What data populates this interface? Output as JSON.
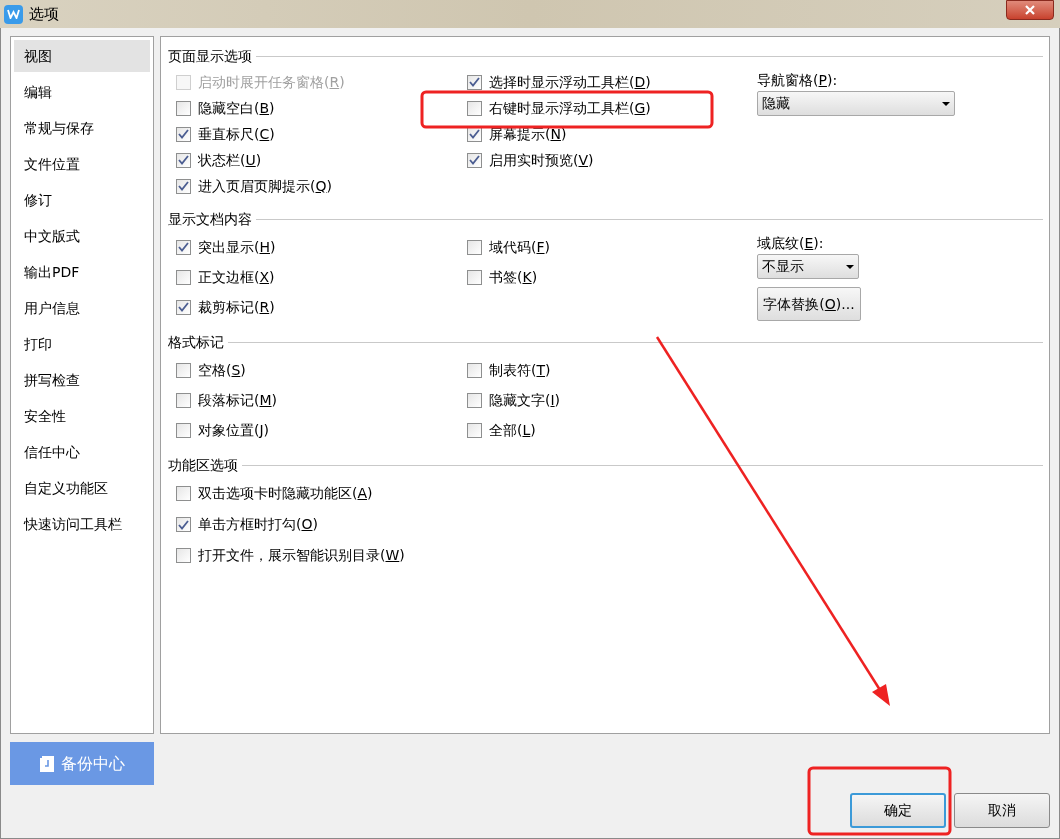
{
  "window": {
    "title": "选项"
  },
  "sidebar": {
    "items": [
      {
        "label": "视图",
        "selected": true
      },
      {
        "label": "编辑",
        "selected": false
      },
      {
        "label": "常规与保存",
        "selected": false
      },
      {
        "label": "文件位置",
        "selected": false
      },
      {
        "label": "修订",
        "selected": false
      },
      {
        "label": "中文版式",
        "selected": false
      },
      {
        "label": "输出PDF",
        "selected": false
      },
      {
        "label": "用户信息",
        "selected": false
      },
      {
        "label": "打印",
        "selected": false
      },
      {
        "label": "拼写检查",
        "selected": false
      },
      {
        "label": "安全性",
        "selected": false
      },
      {
        "label": "信任中心",
        "selected": false
      },
      {
        "label": "自定义功能区",
        "selected": false
      },
      {
        "label": "快速访问工具栏",
        "selected": false
      }
    ]
  },
  "backup_button": {
    "label": "备份中心"
  },
  "sections": [
    {
      "title": "页面显示选项",
      "left": [
        {
          "before": "启动时展开任务窗格(",
          "key": "R",
          "after": ")",
          "checked": false,
          "disabled": true
        },
        {
          "before": "隐藏空白(",
          "key": "B",
          "after": ")",
          "checked": false,
          "disabled": false
        },
        {
          "before": "垂直标尺(",
          "key": "C",
          "after": ")",
          "checked": true,
          "disabled": false
        },
        {
          "before": "状态栏(",
          "key": "U",
          "after": ")",
          "checked": true,
          "disabled": false
        },
        {
          "before": "进入页眉页脚提示(",
          "key": "Q",
          "after": ")",
          "checked": true,
          "disabled": false
        }
      ],
      "right": [
        {
          "before": "选择时显示浮动工具栏(",
          "key": "D",
          "after": ")",
          "checked": true,
          "disabled": false
        },
        {
          "before": "右键时显示浮动工具栏(",
          "key": "G",
          "after": ")",
          "checked": false,
          "disabled": false
        },
        {
          "before": "屏幕提示(",
          "key": "N",
          "after": ")",
          "checked": true,
          "disabled": false
        },
        {
          "before": "启用实时预览(",
          "key": "V",
          "after": ")",
          "checked": true,
          "disabled": false
        }
      ],
      "side": [
        {
          "kind": "label",
          "before": "导航窗格(",
          "key": "P",
          "after": "):"
        },
        {
          "kind": "select",
          "value": "隐藏"
        }
      ]
    },
    {
      "title": "显示文档内容",
      "left": [
        {
          "before": "突出显示(",
          "key": "H",
          "after": ")",
          "checked": true,
          "disabled": false
        },
        {
          "before": "正文边框(",
          "key": "X",
          "after": ")",
          "checked": false,
          "disabled": false
        },
        {
          "before": "裁剪标记(",
          "key": "R",
          "after": ")",
          "checked": true,
          "disabled": false
        }
      ],
      "right": [
        {
          "before": "域代码(",
          "key": "F",
          "after": ")",
          "checked": false,
          "disabled": false
        },
        {
          "before": "书签(",
          "key": "K",
          "after": ")",
          "checked": false,
          "disabled": false
        }
      ],
      "side": [
        {
          "kind": "label",
          "before": "域底纹(",
          "key": "E",
          "after": "):"
        },
        {
          "kind": "select",
          "value": "不显示"
        },
        {
          "kind": "button",
          "before": "字体替换(",
          "key": "O",
          "after": ")..."
        }
      ]
    },
    {
      "title": "格式标记",
      "left": [
        {
          "before": "空格(",
          "key": "S",
          "after": ")",
          "checked": false,
          "disabled": false
        },
        {
          "before": "段落标记(",
          "key": "M",
          "after": ")",
          "checked": false,
          "disabled": false
        },
        {
          "before": "对象位置(",
          "key": "J",
          "after": ")",
          "checked": false,
          "disabled": false
        }
      ],
      "right": [
        {
          "before": "制表符(",
          "key": "T",
          "after": ")",
          "checked": false,
          "disabled": false
        },
        {
          "before": "隐藏文字(",
          "key": "I",
          "after": ")",
          "checked": false,
          "disabled": false
        },
        {
          "before": "全部(",
          "key": "L",
          "after": ")",
          "checked": false,
          "disabled": false
        }
      ]
    },
    {
      "title": "功能区选项",
      "left": [
        {
          "before": "双击选项卡时隐藏功能区(",
          "key": "A",
          "after": ")",
          "checked": false,
          "disabled": false
        },
        {
          "before": "单击方框时打勾(",
          "key": "O",
          "after": ")",
          "checked": true,
          "disabled": false
        },
        {
          "before": "打开文件，展示智能识别目录(",
          "key": "W",
          "after": ")",
          "checked": false,
          "disabled": false
        }
      ]
    }
  ],
  "buttons": [
    {
      "label": "确定",
      "selected": true
    },
    {
      "label": "取消",
      "selected": false
    }
  ]
}
